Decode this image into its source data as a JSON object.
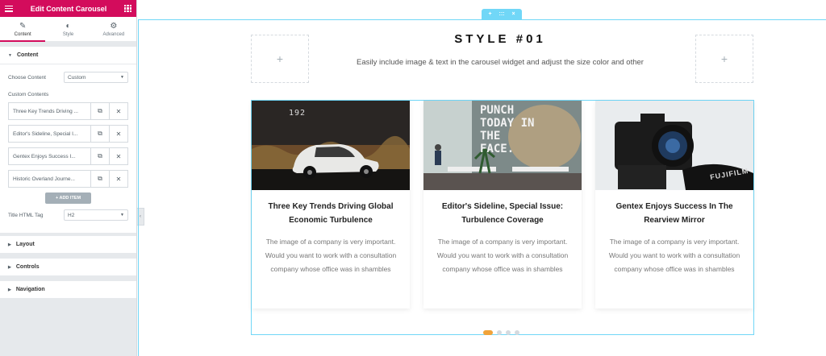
{
  "panel": {
    "title": "Edit Content Carousel",
    "tabs": [
      {
        "label": "Content",
        "icon": "pencil-icon"
      },
      {
        "label": "Style",
        "icon": "half-circle-icon"
      },
      {
        "label": "Advanced",
        "icon": "gear-icon"
      }
    ],
    "content_section": "Content",
    "choose_content_label": "Choose Content",
    "choose_content_value": "Custom",
    "custom_contents_label": "Custom Contents",
    "items": [
      {
        "title": "Three Key Trends Driving ..."
      },
      {
        "title": "Editor's Sideline, Special I..."
      },
      {
        "title": "Gentex Enjoys Success I..."
      },
      {
        "title": "Historic Overland Journe..."
      }
    ],
    "add_item": "+ ADD ITEM",
    "title_tag_label": "Title HTML Tag",
    "title_tag_value": "H2",
    "sections": [
      "Layout",
      "Controls",
      "Navigation"
    ]
  },
  "canvas": {
    "handle": {
      "add": "+",
      "move": ":::",
      "close": "×"
    },
    "placeholder_plus": "+",
    "heading": "STYLE #01",
    "subheading": "Easily include image & text in the carousel widget and adjust the size color and other",
    "cards": [
      {
        "title": "Three Key Trends Driving Global Economic Turbulence",
        "text": "The image of a company is very important. Would you want to work with a consultation company whose office was in shambles",
        "image_caption": "192"
      },
      {
        "title": "Editor's Sideline, Special Issue: Turbulence Coverage",
        "text": "The image of a company is very important. Would you want to work with a consultation company whose office was in shambles",
        "image_caption": "PUNCH TODAY IN THE FACE."
      },
      {
        "title": "Gentex Enjoys Success In The Rearview Mirror",
        "text": "The image of a company is very important. Would you want to work with a consultation company whose office was in shambles",
        "image_caption": "FUJIFILM"
      }
    ],
    "dots": 4,
    "active_dot": 0
  },
  "colors": {
    "brand": "#d30c5c",
    "outline": "#71d7f7",
    "dot_active": "#f0a33a"
  }
}
